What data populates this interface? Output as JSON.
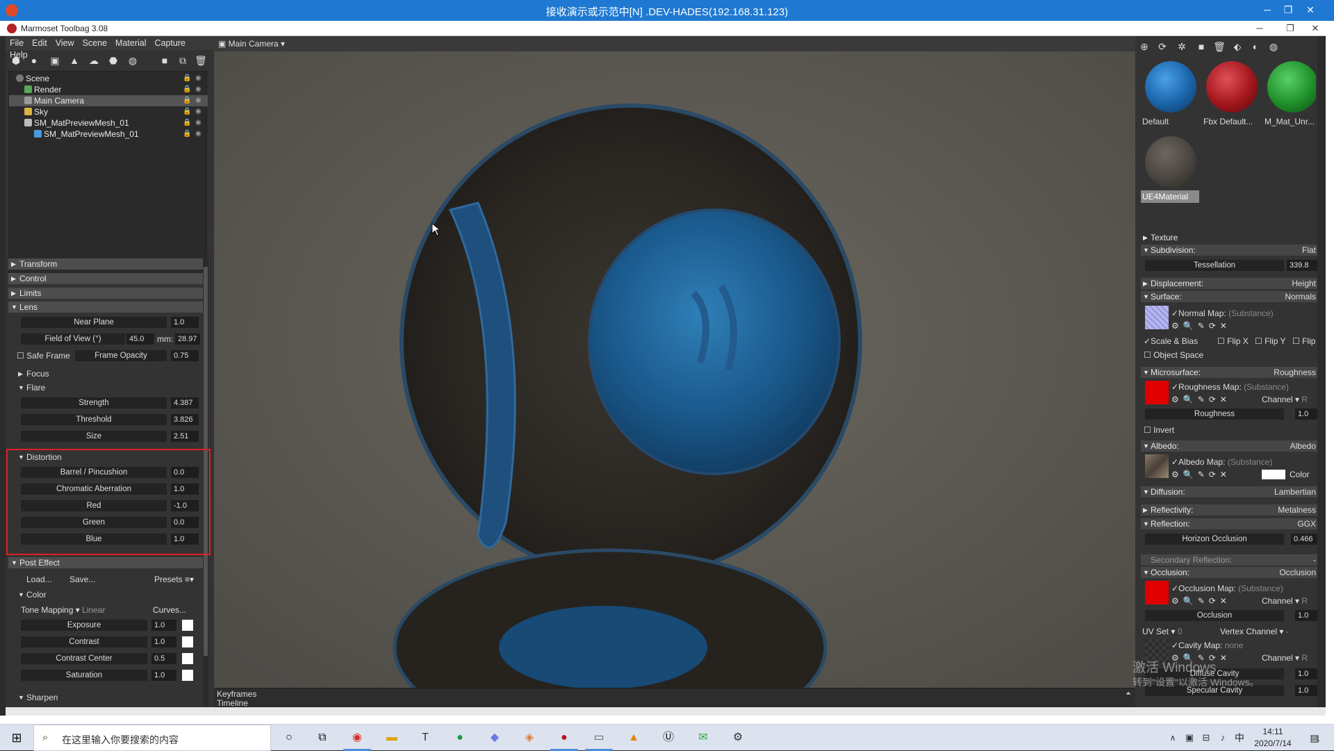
{
  "remote_desktop": {
    "title": "接收演示或示范中[N] .DEV-HADES(192.168.31.123)",
    "minimize": "─",
    "restore": "❐",
    "close": "✕"
  },
  "app": {
    "title": "Marmoset Toolbag 3.08",
    "minimize": "─",
    "restore": "❐",
    "close": "✕"
  },
  "menu": [
    "File",
    "Edit",
    "View",
    "Scene",
    "Material",
    "Capture",
    "Help"
  ],
  "scene_tree": [
    {
      "label": "Scene",
      "icon": "scene-icon"
    },
    {
      "label": "Render",
      "icon": "render-icon"
    },
    {
      "label": "Main Camera",
      "icon": "camera-icon",
      "selected": true
    },
    {
      "label": "Sky",
      "icon": "sky-icon"
    },
    {
      "label": "SM_MatPreviewMesh_01",
      "icon": "mesh-icon"
    },
    {
      "label": "SM_MatPreviewMesh_01",
      "icon": "submesh-icon"
    }
  ],
  "left_props": {
    "transform": "Transform",
    "control": "Control",
    "limits": "Limits",
    "lens": "Lens",
    "near_plane": {
      "label": "Near Plane",
      "value": "1.0"
    },
    "fov": {
      "label": "Field of View (°)",
      "value": "45.0",
      "mm_label": "mm:",
      "mm_value": "28.97"
    },
    "safe_frame": "Safe Frame",
    "frame_opacity": {
      "label": "Frame Opacity",
      "value": "0.75"
    },
    "focus": "Focus",
    "flare": "Flare",
    "strength": {
      "label": "Strength",
      "value": "4.387"
    },
    "threshold": {
      "label": "Threshold",
      "value": "3.826"
    },
    "size": {
      "label": "Size",
      "value": "2.51"
    },
    "distortion": "Distortion",
    "barrel": {
      "label": "Barrel / Pincushion",
      "value": "0.0"
    },
    "chromatic": {
      "label": "Chromatic Aberration",
      "value": "1.0"
    },
    "red": {
      "label": "Red",
      "value": "-1.0"
    },
    "green": {
      "label": "Green",
      "value": "0.0"
    },
    "blue": {
      "label": "Blue",
      "value": "1.0"
    },
    "post_effect": "Post Effect",
    "load": "Load...",
    "save": "Save...",
    "presets": "Presets ≡▾",
    "color": "Color",
    "tone_mapping": "Tone Mapping ▾",
    "tone_value": "Linear",
    "curves": "Curves...",
    "exposure": {
      "label": "Exposure",
      "value": "1.0"
    },
    "contrast": {
      "label": "Contrast",
      "value": "1.0"
    },
    "contrast_center": {
      "label": "Contrast Center",
      "value": "0.5"
    },
    "saturation": {
      "label": "Saturation",
      "value": "1.0"
    },
    "sharpen": "Sharpen"
  },
  "viewport": {
    "camera": "Main Camera ▾",
    "keyframes": "Keyframes",
    "timeline": "Timeline"
  },
  "materials": [
    {
      "name": "Default",
      "color": "#1a63a8"
    },
    {
      "name": "Fbx Default...",
      "color": "#a3161c"
    },
    {
      "name": "M_Mat_Unr...",
      "color": "#1f8f2a"
    },
    {
      "name": "UE4Material",
      "color": "#4a4540",
      "selected": true
    }
  ],
  "right_props": {
    "texture": "Texture",
    "subdivision": "Subdivision:",
    "subdivision_v": "Flat",
    "tessellation": "Tessellation",
    "tessellation_v": "339.8",
    "displacement": "Displacement:",
    "displacement_v": "Height",
    "surface": "Surface:",
    "surface_v": "Normals",
    "normal_map": "✓Normal Map:",
    "normal_map_v": "(Substance)",
    "scale_bias": "✓Scale & Bias",
    "flip_x": "Flip X",
    "flip_y": "Flip Y",
    "flip": "Flip",
    "object_space": "Object Space",
    "microsurface": "Microsurface:",
    "microsurface_v": "Roughness",
    "roughness_map": "✓Roughness Map:",
    "roughness_map_v": "(Substance)",
    "channel": "Channel ▾",
    "channel_r": "R",
    "roughness": "Roughness",
    "roughness_v": "1.0",
    "invert": "Invert",
    "albedo": "Albedo:",
    "albedo_v": "Albedo",
    "albedo_map": "✓Albedo Map:",
    "albedo_map_v": "(Substance)",
    "color": "Color",
    "diffusion": "Diffusion:",
    "diffusion_v": "Lambertian",
    "reflectivity": "Reflectivity:",
    "reflectivity_v": "Metalness",
    "reflection": "Reflection:",
    "reflection_v": "GGX",
    "horizon": "Horizon Occlusion",
    "horizon_v": "0.466",
    "secondary": "Secondary Reflection:",
    "secondary_v": "-",
    "occlusion": "Occlusion:",
    "occlusion_v": "Occlusion",
    "occlusion_map": "✓Occlusion Map:",
    "occlusion_map_v": "(Substance)",
    "occlusion_f": "Occlusion",
    "occlusion_f_v": "1.0",
    "uv_set": "UV Set ▾",
    "uv_set_v": "0",
    "vertex_channel": "Vertex Channel ▾",
    "vertex_channel_v": "-",
    "cavity_map": "✓Cavity Map:",
    "cavity_map_v": "none",
    "diffuse_cavity": "Diffuse Cavity",
    "diffuse_cavity_v": "1.0",
    "specular_cavity": "Specular Cavity",
    "specular_cavity_v": "1.0"
  },
  "watermark": {
    "line1": "激活 Windows",
    "line2": "转到\"设置\"以激活 Windows。"
  },
  "taskbar": {
    "search_placeholder": "在这里输入你要搜索的内容",
    "ime": "中",
    "time": "14:11",
    "date": "2020/7/14",
    "notifications": "1"
  }
}
